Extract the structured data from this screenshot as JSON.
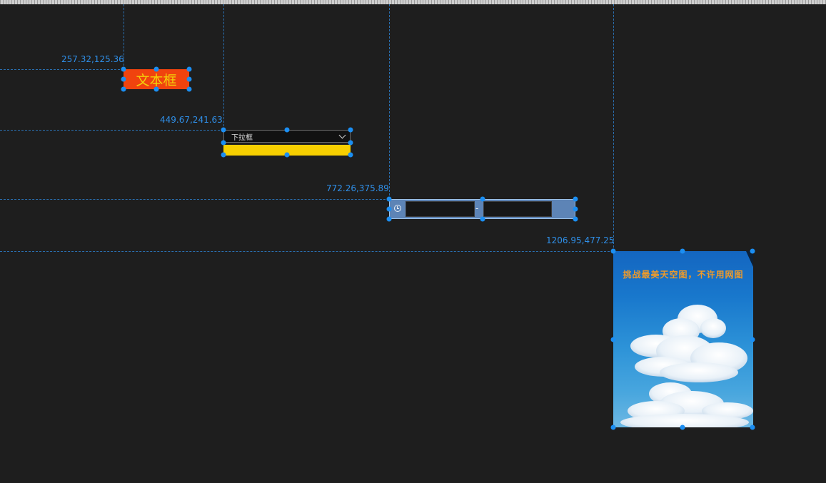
{
  "coordinates": {
    "textbox": "257.32,125.36",
    "dropdown": "449.67,241.63",
    "timerange": "772.26,375.89",
    "image": "1206.95,477.25"
  },
  "textbox": {
    "label": "文本框"
  },
  "dropdown": {
    "selected": "下拉框"
  },
  "timerange": {
    "separator": "-",
    "start_value": "",
    "end_value": ""
  },
  "image": {
    "caption": "挑战最美天空图，不许用网图"
  },
  "colors": {
    "textbox_bg": "#f0430e",
    "textbox_text": "#f2d20a",
    "dropdown_bar": "#f7cf00",
    "timerange_bg": "#5d84b6",
    "guide": "#2a6fb0",
    "coord_text": "#2f8fe8",
    "handle": "#1b8ef2"
  }
}
